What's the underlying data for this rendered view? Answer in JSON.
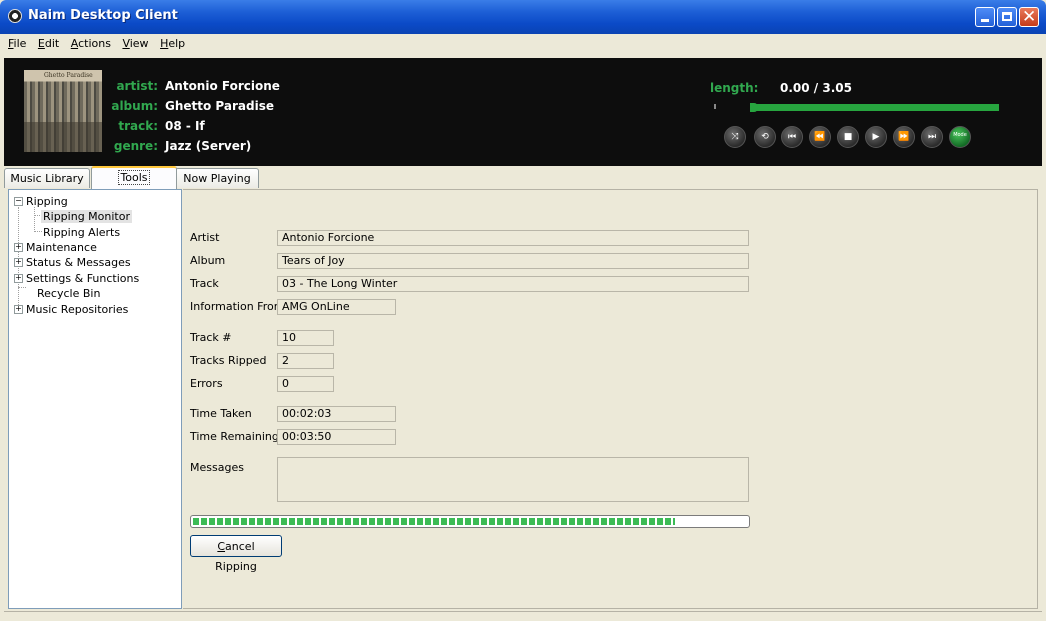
{
  "window": {
    "title": "Naim Desktop Client"
  },
  "menu": [
    {
      "label": "File",
      "mnemonic": "F",
      "rest": "ile"
    },
    {
      "label": "Edit",
      "mnemonic": "E",
      "rest": "dit"
    },
    {
      "label": "Actions",
      "mnemonic": "A",
      "rest": "ctions"
    },
    {
      "label": "View",
      "mnemonic": "V",
      "rest": "iew"
    },
    {
      "label": "Help",
      "mnemonic": "H",
      "rest": "elp"
    }
  ],
  "now_playing": {
    "art_title": "Ghetto Paradise",
    "labels": {
      "artist": "artist:",
      "album": "album:",
      "track": "track:",
      "genre": "genre:",
      "length": "length:"
    },
    "artist": "Antonio Forcione",
    "album": "Ghetto Paradise",
    "track": "08 - If",
    "genre": "Jazz (Server)",
    "length": "0.00 / 3.05",
    "position_fraction": 0.0,
    "mode_label": "Mode"
  },
  "tabs": [
    {
      "label": "Music Library",
      "active": false
    },
    {
      "label": "Tools",
      "active": true
    },
    {
      "label": "Now Playing",
      "active": false
    }
  ],
  "tree": {
    "ripping": "Ripping",
    "ripping_monitor": "Ripping Monitor",
    "ripping_alerts": "Ripping Alerts",
    "maintenance": "Maintenance",
    "status_messages": "Status & Messages",
    "settings_functions": "Settings & Functions",
    "recycle_bin": "Recycle Bin",
    "music_repositories": "Music Repositories"
  },
  "monitor": {
    "labels": {
      "artist": "Artist",
      "album": "Album",
      "track": "Track",
      "info_from": "Information From",
      "track_num": "Track #",
      "tracks_ripped": "Tracks Ripped",
      "errors": "Errors",
      "time_taken": "Time Taken",
      "time_remaining": "Time Remaining",
      "messages": "Messages"
    },
    "artist": "Antonio Forcione",
    "album": "Tears of Joy",
    "track": "03 - The Long Winter",
    "info_from": "AMG OnLine",
    "track_num": "10",
    "tracks_ripped": "2",
    "errors": "0",
    "time_taken": "00:02:03",
    "time_remaining": "00:03:50",
    "messages": "",
    "progress_fraction": 0.87,
    "cancel_label": {
      "mnemonic": "C",
      "rest": "ancel Ripping"
    }
  },
  "colors": {
    "accent_green": "#31a84f",
    "progress_green": "#3cbb55",
    "titlebar_blue": "#0b4ac7",
    "player_bg": "#0d0d0d",
    "window_bg": "#ece9d8"
  },
  "icons": {
    "shuffle": "shuffle-icon",
    "repeat": "repeat-icon",
    "skip_start": "skip-to-start-icon",
    "rewind": "rewind-icon",
    "stop": "stop-icon",
    "play": "play-icon",
    "fast_forward": "fast-forward-icon",
    "skip_end": "skip-to-end-icon",
    "mode": "mode-icon"
  }
}
